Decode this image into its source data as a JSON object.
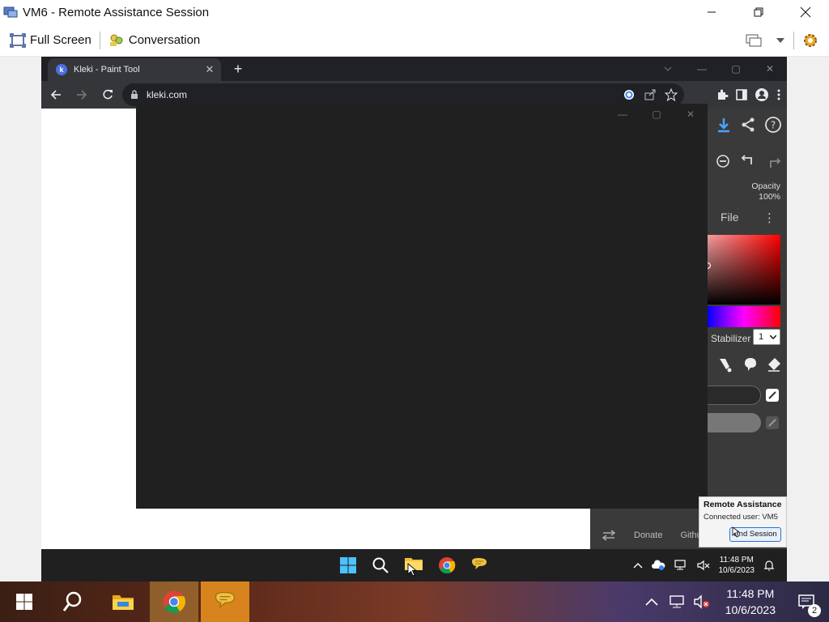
{
  "window": {
    "title": "VM6 - Remote Assistance Session"
  },
  "toolbar": {
    "full_screen_label": "Full Screen",
    "conversation_label": "Conversation"
  },
  "browser": {
    "tab_title": "Kleki - Paint Tool",
    "url": "kleki.com"
  },
  "kleki": {
    "opacity_label": "Opacity",
    "opacity_value": "100%",
    "file_label": "File",
    "stabilizer_label": "Stabilizer",
    "stabilizer_value": "1",
    "bottom_links": [
      "Donate",
      "Github"
    ]
  },
  "remote_popup": {
    "title": "Remote Assistance",
    "connected_user": "Connected user: VM5",
    "end_session_label": "End Session"
  },
  "inner_taskbar": {
    "time": "11:48 PM",
    "date": "10/6/2023"
  },
  "outer_taskbar": {
    "time": "11:48 PM",
    "date": "10/6/2023",
    "notification_count": "2"
  }
}
